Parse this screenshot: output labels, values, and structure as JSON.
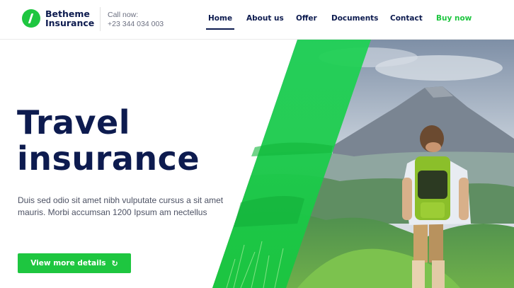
{
  "brand": {
    "line1": "Betheme",
    "line2": "Insurance",
    "accent": "#1ec640",
    "navy": "#0d1b4f"
  },
  "contact": {
    "label": "Call now:",
    "phone": "+23 344 034 003"
  },
  "nav": {
    "home": "Home",
    "about": "About us",
    "offer": "Offer",
    "documents": "Documents",
    "contact": "Contact",
    "buy": "Buy now"
  },
  "hero": {
    "title_line1": "Travel",
    "title_line2": "insurance",
    "description": "Duis sed odio sit amet nibh vulputate cursus a sit amet mauris. Morbi accumsan 1200 Ipsum am nectellus",
    "cta_label": "View more details",
    "cta_icon": "refresh-icon",
    "image": "hiker-mountain-photo"
  }
}
